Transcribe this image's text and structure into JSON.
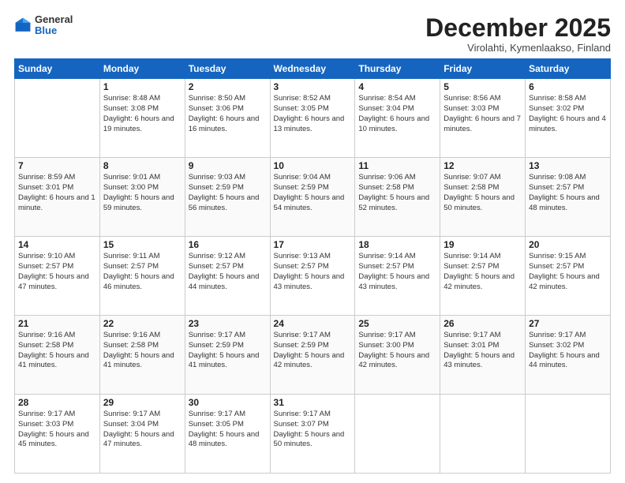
{
  "header": {
    "logo": {
      "general": "General",
      "blue": "Blue"
    },
    "title": "December 2025",
    "location": "Virolahti, Kymenlaakso, Finland"
  },
  "weekdays": [
    "Sunday",
    "Monday",
    "Tuesday",
    "Wednesday",
    "Thursday",
    "Friday",
    "Saturday"
  ],
  "weeks": [
    [
      {
        "day": "",
        "info": ""
      },
      {
        "day": "1",
        "info": "Sunrise: 8:48 AM\nSunset: 3:08 PM\nDaylight: 6 hours\nand 19 minutes."
      },
      {
        "day": "2",
        "info": "Sunrise: 8:50 AM\nSunset: 3:06 PM\nDaylight: 6 hours\nand 16 minutes."
      },
      {
        "day": "3",
        "info": "Sunrise: 8:52 AM\nSunset: 3:05 PM\nDaylight: 6 hours\nand 13 minutes."
      },
      {
        "day": "4",
        "info": "Sunrise: 8:54 AM\nSunset: 3:04 PM\nDaylight: 6 hours\nand 10 minutes."
      },
      {
        "day": "5",
        "info": "Sunrise: 8:56 AM\nSunset: 3:03 PM\nDaylight: 6 hours\nand 7 minutes."
      },
      {
        "day": "6",
        "info": "Sunrise: 8:58 AM\nSunset: 3:02 PM\nDaylight: 6 hours\nand 4 minutes."
      }
    ],
    [
      {
        "day": "7",
        "info": "Sunrise: 8:59 AM\nSunset: 3:01 PM\nDaylight: 6 hours\nand 1 minute."
      },
      {
        "day": "8",
        "info": "Sunrise: 9:01 AM\nSunset: 3:00 PM\nDaylight: 5 hours\nand 59 minutes."
      },
      {
        "day": "9",
        "info": "Sunrise: 9:03 AM\nSunset: 2:59 PM\nDaylight: 5 hours\nand 56 minutes."
      },
      {
        "day": "10",
        "info": "Sunrise: 9:04 AM\nSunset: 2:59 PM\nDaylight: 5 hours\nand 54 minutes."
      },
      {
        "day": "11",
        "info": "Sunrise: 9:06 AM\nSunset: 2:58 PM\nDaylight: 5 hours\nand 52 minutes."
      },
      {
        "day": "12",
        "info": "Sunrise: 9:07 AM\nSunset: 2:58 PM\nDaylight: 5 hours\nand 50 minutes."
      },
      {
        "day": "13",
        "info": "Sunrise: 9:08 AM\nSunset: 2:57 PM\nDaylight: 5 hours\nand 48 minutes."
      }
    ],
    [
      {
        "day": "14",
        "info": "Sunrise: 9:10 AM\nSunset: 2:57 PM\nDaylight: 5 hours\nand 47 minutes."
      },
      {
        "day": "15",
        "info": "Sunrise: 9:11 AM\nSunset: 2:57 PM\nDaylight: 5 hours\nand 46 minutes."
      },
      {
        "day": "16",
        "info": "Sunrise: 9:12 AM\nSunset: 2:57 PM\nDaylight: 5 hours\nand 44 minutes."
      },
      {
        "day": "17",
        "info": "Sunrise: 9:13 AM\nSunset: 2:57 PM\nDaylight: 5 hours\nand 43 minutes."
      },
      {
        "day": "18",
        "info": "Sunrise: 9:14 AM\nSunset: 2:57 PM\nDaylight: 5 hours\nand 43 minutes."
      },
      {
        "day": "19",
        "info": "Sunrise: 9:14 AM\nSunset: 2:57 PM\nDaylight: 5 hours\nand 42 minutes."
      },
      {
        "day": "20",
        "info": "Sunrise: 9:15 AM\nSunset: 2:57 PM\nDaylight: 5 hours\nand 42 minutes."
      }
    ],
    [
      {
        "day": "21",
        "info": "Sunrise: 9:16 AM\nSunset: 2:58 PM\nDaylight: 5 hours\nand 41 minutes."
      },
      {
        "day": "22",
        "info": "Sunrise: 9:16 AM\nSunset: 2:58 PM\nDaylight: 5 hours\nand 41 minutes."
      },
      {
        "day": "23",
        "info": "Sunrise: 9:17 AM\nSunset: 2:59 PM\nDaylight: 5 hours\nand 41 minutes."
      },
      {
        "day": "24",
        "info": "Sunrise: 9:17 AM\nSunset: 2:59 PM\nDaylight: 5 hours\nand 42 minutes."
      },
      {
        "day": "25",
        "info": "Sunrise: 9:17 AM\nSunset: 3:00 PM\nDaylight: 5 hours\nand 42 minutes."
      },
      {
        "day": "26",
        "info": "Sunrise: 9:17 AM\nSunset: 3:01 PM\nDaylight: 5 hours\nand 43 minutes."
      },
      {
        "day": "27",
        "info": "Sunrise: 9:17 AM\nSunset: 3:02 PM\nDaylight: 5 hours\nand 44 minutes."
      }
    ],
    [
      {
        "day": "28",
        "info": "Sunrise: 9:17 AM\nSunset: 3:03 PM\nDaylight: 5 hours\nand 45 minutes."
      },
      {
        "day": "29",
        "info": "Sunrise: 9:17 AM\nSunset: 3:04 PM\nDaylight: 5 hours\nand 47 minutes."
      },
      {
        "day": "30",
        "info": "Sunrise: 9:17 AM\nSunset: 3:05 PM\nDaylight: 5 hours\nand 48 minutes."
      },
      {
        "day": "31",
        "info": "Sunrise: 9:17 AM\nSunset: 3:07 PM\nDaylight: 5 hours\nand 50 minutes."
      },
      {
        "day": "",
        "info": ""
      },
      {
        "day": "",
        "info": ""
      },
      {
        "day": "",
        "info": ""
      }
    ]
  ]
}
